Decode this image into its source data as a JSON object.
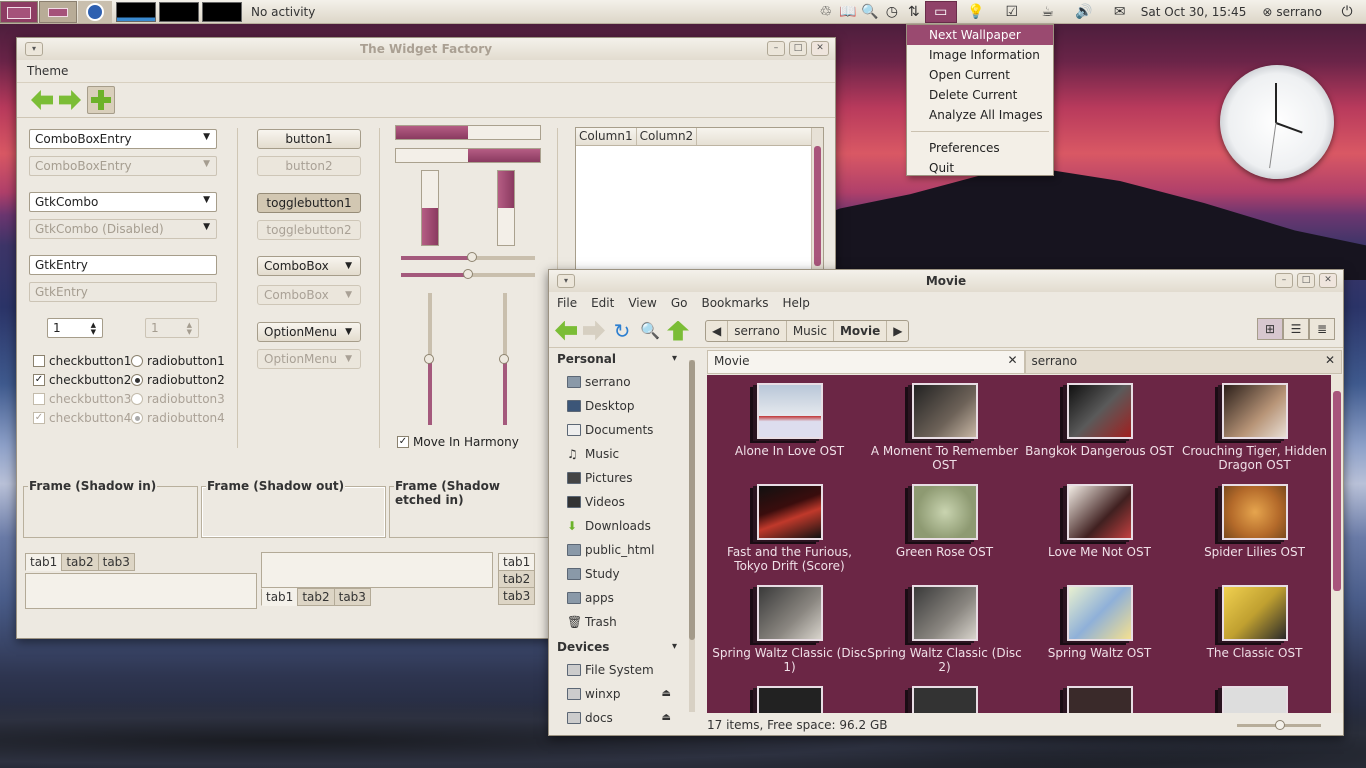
{
  "panel": {
    "activity": "No activity",
    "datetime": "Sat Oct 30, 15:45",
    "user": "serrano"
  },
  "context_menu": {
    "items": [
      "Next Wallpaper",
      "Image Information",
      "Open Current",
      "Delete Current",
      "Analyze All Images"
    ],
    "items2": [
      "Preferences",
      "Quit"
    ]
  },
  "widget_factory": {
    "title": "The Widget Factory",
    "menu": "Theme",
    "combo1": "ComboBoxEntry",
    "combo2": "ComboBoxEntry",
    "gtkcombo": "GtkCombo",
    "gtkcombo_dis": "GtkCombo (Disabled)",
    "entry1": "GtkEntry",
    "entry2": "GtkEntry",
    "spin1": "1",
    "spin2": "1",
    "checks": [
      "checkbutton1",
      "checkbutton2",
      "checkbutton3",
      "checkbutton4"
    ],
    "radios": [
      "radiobutton1",
      "radiobutton2",
      "radiobutton3",
      "radiobutton4"
    ],
    "buttons": [
      "button1",
      "button2",
      "togglebutton1",
      "togglebutton2",
      "ComboBox",
      "ComboBox",
      "OptionMenu",
      "OptionMenu"
    ],
    "progress": {
      "h1": 0.5,
      "h2": 0.5,
      "v1": 0.5,
      "v2": 0.5
    },
    "move_in_harmony": "Move In Harmony",
    "columns": [
      "Column1",
      "Column2"
    ],
    "frames": [
      "Frame (Shadow in)",
      "Frame (Shadow out)",
      "Frame (Shadow etched in)"
    ],
    "tabs": [
      "tab1",
      "tab2",
      "tab3"
    ]
  },
  "file_manager": {
    "title": "Movie",
    "menu": [
      "File",
      "Edit",
      "View",
      "Go",
      "Bookmarks",
      "Help"
    ],
    "path": [
      "serrano",
      "Music",
      "Movie"
    ],
    "sidebar": {
      "personal_header": "Personal",
      "personal": [
        "serrano",
        "Desktop",
        "Documents",
        "Music",
        "Pictures",
        "Videos",
        "Downloads",
        "public_html",
        "Study",
        "apps",
        "Trash"
      ],
      "devices_header": "Devices",
      "devices": [
        "File System",
        "winxp",
        "docs"
      ]
    },
    "tabs": [
      "Movie",
      "serrano"
    ],
    "items": [
      "Alone In Love OST",
      "A Moment To Remember OST",
      "Bangkok Dangerous OST",
      "Crouching Tiger, Hidden Dragon OST",
      "Fast and the Furious, Tokyo Drift (Score)",
      "Green Rose OST",
      "Love Me Not OST",
      "Spider Lilies OST",
      "Spring Waltz Classic (Disc 1)",
      "Spring Waltz Classic (Disc 2)",
      "Spring Waltz OST",
      "The Classic OST"
    ],
    "status": "17 items, Free space: 96.2 GB"
  },
  "colors": {
    "accent": "#8f4268",
    "folder_bg": "#6b2645"
  }
}
